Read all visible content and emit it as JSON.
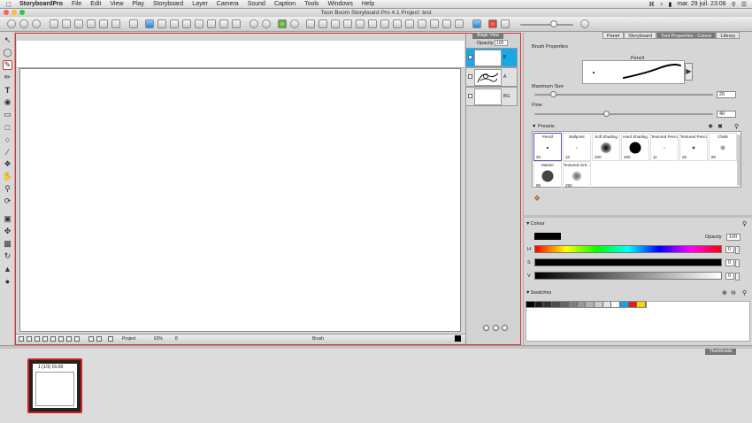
{
  "menubar": {
    "app_name": "StoryboardPro",
    "items": [
      "File",
      "Edit",
      "View",
      "Play",
      "Storyboard",
      "Layer",
      "Camera",
      "Sound",
      "Caption",
      "Tools",
      "Windows",
      "Help"
    ],
    "clock": "mar. 29 juil.  23:08"
  },
  "window": {
    "title": "Toon Boom Storyboard Pro 4.1 Project: test"
  },
  "stage": {
    "tab_label": "Stage View",
    "opacity_label": "Opacity",
    "opacity_value": "100",
    "statusbar": {
      "project_label": "Project",
      "zoom": "63%",
      "frame": "8",
      "tool": "Brush"
    },
    "layers": [
      {
        "name": "B",
        "selected": true
      },
      {
        "name": "A",
        "selected": false
      },
      {
        "name": "BG",
        "selected": false
      }
    ]
  },
  "right_panel": {
    "tabs": [
      "Panel",
      "Storyboard",
      "Tool Properties : Colour",
      "Library"
    ],
    "active_tab": "Tool Properties : Colour",
    "brush_properties_title": "Brush Properties",
    "brush_name": "Pencil",
    "maximum_size_label": "Maximum Size",
    "maximum_size_value": "20",
    "flow_label": "Flow",
    "flow_value": "40",
    "presets_label": "Presets",
    "presets": [
      {
        "name": "Pencil",
        "value": "20"
      },
      {
        "name": "Ballpoint",
        "value": "10"
      },
      {
        "name": "Soft Shading",
        "value": "200"
      },
      {
        "name": "Hard Shading",
        "value": "200"
      },
      {
        "name": "Textured Penci...",
        "value": "11"
      },
      {
        "name": "Textured Penci...",
        "value": "25"
      },
      {
        "name": "Chalk",
        "value": "80"
      },
      {
        "name": "Marker",
        "value": "95"
      },
      {
        "name": "Textured Airb...",
        "value": "250"
      }
    ],
    "colour_label": "Colour",
    "colour_opacity_label": "Opacity",
    "colour_opacity_value": "100",
    "h_label": "H",
    "h_value": "0",
    "s_label": "S",
    "s_value": "0",
    "v_label": "V",
    "v_value": "0",
    "current_colour": "#000000",
    "swatches_label": "Swatches",
    "swatches": [
      "#000000",
      "#1a1a1a",
      "#333333",
      "#4d4d4d",
      "#666666",
      "#808080",
      "#999999",
      "#b3b3b3",
      "#cccccc",
      "#e6e6e6",
      "#ffffff",
      "#1aa0e8",
      "#e81a1a",
      "#ffd200"
    ]
  },
  "thumbnails": {
    "tab_label": "Thumbnails",
    "panel_label": "1 (1/1) 01:00"
  }
}
